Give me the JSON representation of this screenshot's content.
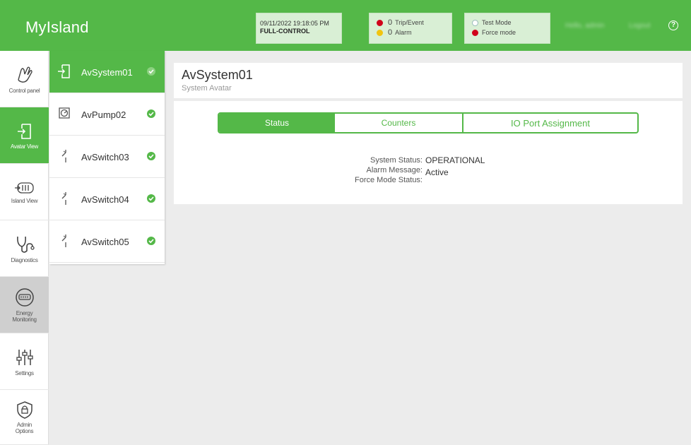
{
  "app": {
    "brand": "MyIsland"
  },
  "header": {
    "datetime": "09/11/2022 19:18:05 PM",
    "control_mode": "FULL-CONTROL",
    "trip_count": "0",
    "trip_label": "Trip/Event",
    "alarm_count": "0",
    "alarm_label": "Alarm",
    "test_mode_label": "Test Mode",
    "force_mode_label": "Force mode",
    "user_greeting": "Hello, admin",
    "logout_label": "Logout",
    "help_glyph": "?"
  },
  "nav": [
    {
      "label": "Control panel",
      "icon": "hand-icon",
      "state": "normal"
    },
    {
      "label": "Avatar View",
      "icon": "avatar-view-icon",
      "state": "active"
    },
    {
      "label": "Island View",
      "icon": "island-view-icon",
      "state": "normal"
    },
    {
      "label": "Diagnostics",
      "icon": "stethoscope-icon",
      "state": "normal"
    },
    {
      "label": "Energy Monitoring",
      "icon": "energy-meter-icon",
      "state": "disabled"
    },
    {
      "label": "Settings",
      "icon": "sliders-icon",
      "state": "normal"
    },
    {
      "label": "Admin Options",
      "icon": "shield-lock-icon",
      "state": "normal"
    }
  ],
  "avatars": [
    {
      "name": "AvSystem01",
      "icon": "system-avatar-icon",
      "selected": true,
      "ok": true
    },
    {
      "name": "AvPump02",
      "icon": "pump-icon",
      "selected": false,
      "ok": true
    },
    {
      "name": "AvSwitch03",
      "icon": "switch-icon",
      "selected": false,
      "ok": true
    },
    {
      "name": "AvSwitch04",
      "icon": "switch-icon",
      "selected": false,
      "ok": true
    },
    {
      "name": "AvSwitch05",
      "icon": "switch-icon",
      "selected": false,
      "ok": true
    }
  ],
  "main": {
    "title": "AvSystem01",
    "subtitle": "System Avatar",
    "tabs": [
      {
        "label": "Status",
        "active": true
      },
      {
        "label": "Counters",
        "active": false
      },
      {
        "label": "IO Port Assignment",
        "active": false
      }
    ],
    "status": {
      "system_status_label": "System Status:",
      "system_status_value": "OPERATIONAL",
      "alarm_message_label": "Alarm Message:",
      "alarm_message_value": "",
      "force_mode_label": "Force Mode Status:",
      "force_mode_value": "Active"
    }
  },
  "colors": {
    "brand_green": "#54b848",
    "header_box": "#d9efd5",
    "trip_red": "#d0021b",
    "alarm_yellow": "#f1c40f"
  }
}
